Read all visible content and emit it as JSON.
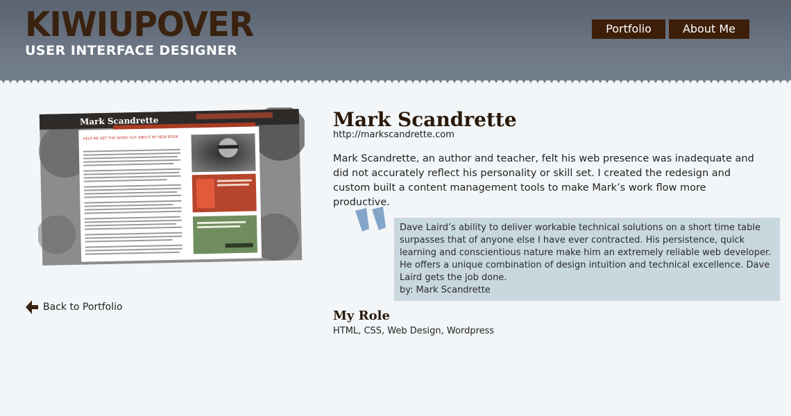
{
  "brand": {
    "name": "KIWIUPOVER",
    "tagline": "USER INTERFACE DESIGNER"
  },
  "nav": {
    "portfolio": "Portfolio",
    "about": "About Me"
  },
  "back": {
    "label": "Back to Portfolio"
  },
  "project": {
    "title": "Mark Scandrette",
    "url": "http://markscandrette.com",
    "description": "Mark Scandrette, an author and teacher, felt his web presence was inadequate and did not accurately reflect his personality or skill set.  I created the redesign and custom built a content management tools to make Mark’s work flow more productive."
  },
  "testimonial": {
    "text": "Dave Laird’s ability to deliver workable technical solutions on a short time table surpasses that of anyone else I have ever contracted. His persistence, quick learning and conscientious nature make him an extremely reliable web developer. He offers a unique combination of design intuition and technical excellence. Dave Laird gets the job done.",
    "byline": "by: Mark Scandrette"
  },
  "role": {
    "title": "My Role",
    "items": "HTML, CSS, Web Design, Wordpress"
  },
  "screenshot": {
    "site_title": "Mark Scandrette",
    "headline": "HELP ME GET THE WORD OUT ABOUT MY NEW BOOK"
  },
  "colors": {
    "header": "#5f6874",
    "brand_brown": "#3a2210",
    "nav_bg": "#3d1e08",
    "quote_bg": "#c9d8df",
    "quote_mark": "#6f97c0",
    "page_bg": "#f3f6f8"
  },
  "icons": {
    "back": "arrow-left-icon",
    "quote": "quote-mark-icon"
  }
}
